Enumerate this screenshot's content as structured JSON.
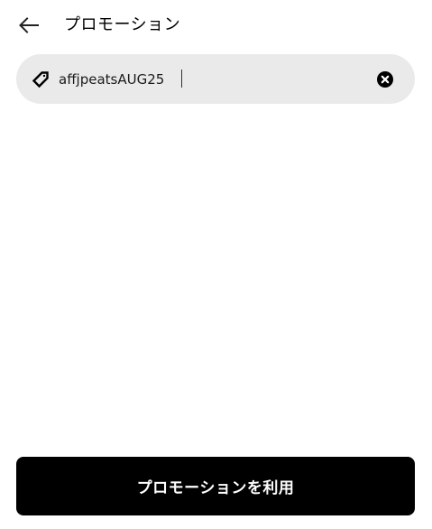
{
  "header": {
    "title": "プロモーション",
    "back_icon": "arrow-left-icon"
  },
  "promo_field": {
    "value": "affjpeatsAUG25",
    "tag_icon": "tag-icon",
    "clear_icon": "clear-icon",
    "background": "#eaeaea"
  },
  "footer": {
    "apply_label": "プロモーションを利用",
    "button_color": "#000000"
  }
}
